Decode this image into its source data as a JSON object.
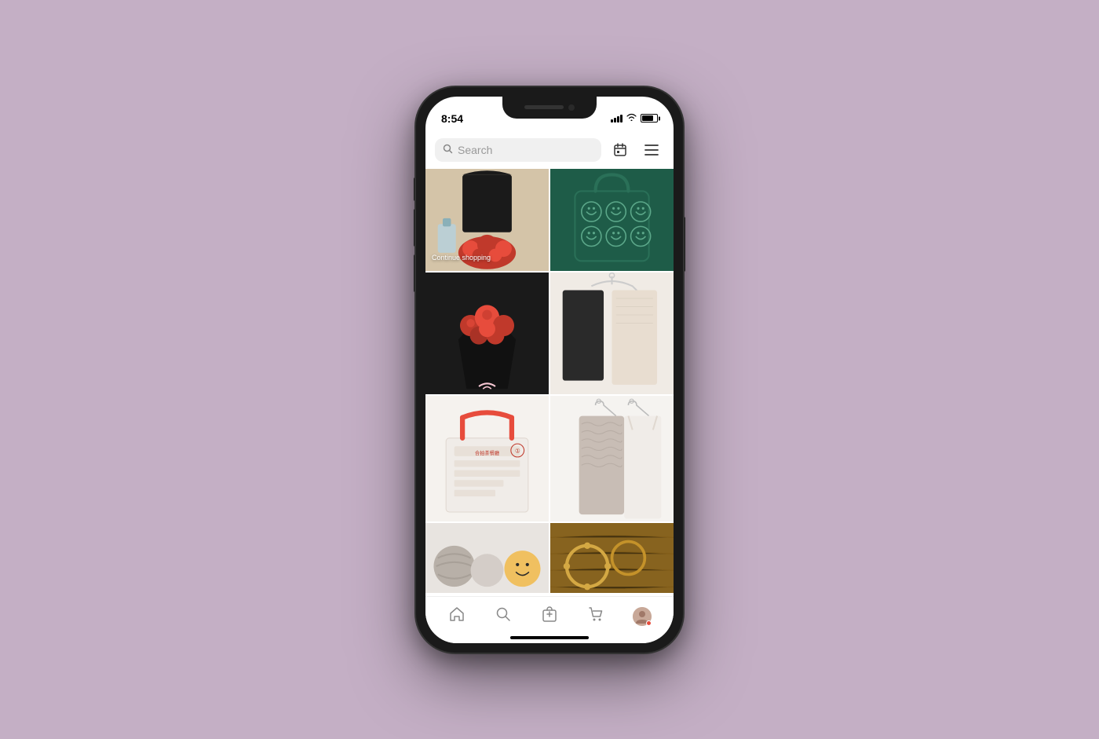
{
  "phone": {
    "status_bar": {
      "time": "8:54"
    },
    "search": {
      "placeholder": "Search"
    },
    "header": {
      "calendar_icon": "calendar-icon",
      "menu_icon": "menu-icon"
    },
    "grid": {
      "items": [
        {
          "id": "lace-black-top",
          "type": "clothing",
          "label": "Continue shopping",
          "show_label": true,
          "bg_color": "#c8b89a"
        },
        {
          "id": "green-smiley-bag",
          "type": "bag",
          "label": "",
          "show_label": false,
          "bg_color": "#1e5c48"
        },
        {
          "id": "red-roses",
          "type": "flowers",
          "label": "",
          "show_label": false,
          "bg_color": "#1a1a1a"
        },
        {
          "id": "beige-clothing",
          "type": "clothing",
          "label": "",
          "show_label": false,
          "bg_color": "#f0ebe5"
        },
        {
          "id": "tote-bag",
          "type": "bag",
          "label": "",
          "show_label": false,
          "bg_color": "#f8f5f0"
        },
        {
          "id": "knit-dress",
          "type": "clothing",
          "label": "",
          "show_label": false,
          "bg_color": "#ddd8d0"
        },
        {
          "id": "crochet-balls",
          "type": "decor",
          "label": "",
          "show_label": false,
          "bg_color": "#c8bdb5"
        },
        {
          "id": "gold-jewelry",
          "type": "jewelry",
          "label": "",
          "show_label": false,
          "bg_color": "#8b6914"
        }
      ]
    },
    "bottom_nav": {
      "items": [
        {
          "id": "home",
          "label": "Home",
          "icon": "🏠",
          "active": false
        },
        {
          "id": "search",
          "label": "Search",
          "icon": "🔍",
          "active": false
        },
        {
          "id": "create",
          "label": "Create",
          "icon": "🛍️",
          "active": false
        },
        {
          "id": "cart",
          "label": "Cart",
          "icon": "🛒",
          "active": false
        },
        {
          "id": "profile",
          "label": "Profile",
          "icon": "👤",
          "active": false
        }
      ]
    },
    "colors": {
      "background": "#c4afc5",
      "phone_body": "#1a1a1a",
      "screen_bg": "#ffffff",
      "search_bg": "#f0f0f0",
      "nav_border": "#eeeeee"
    }
  }
}
